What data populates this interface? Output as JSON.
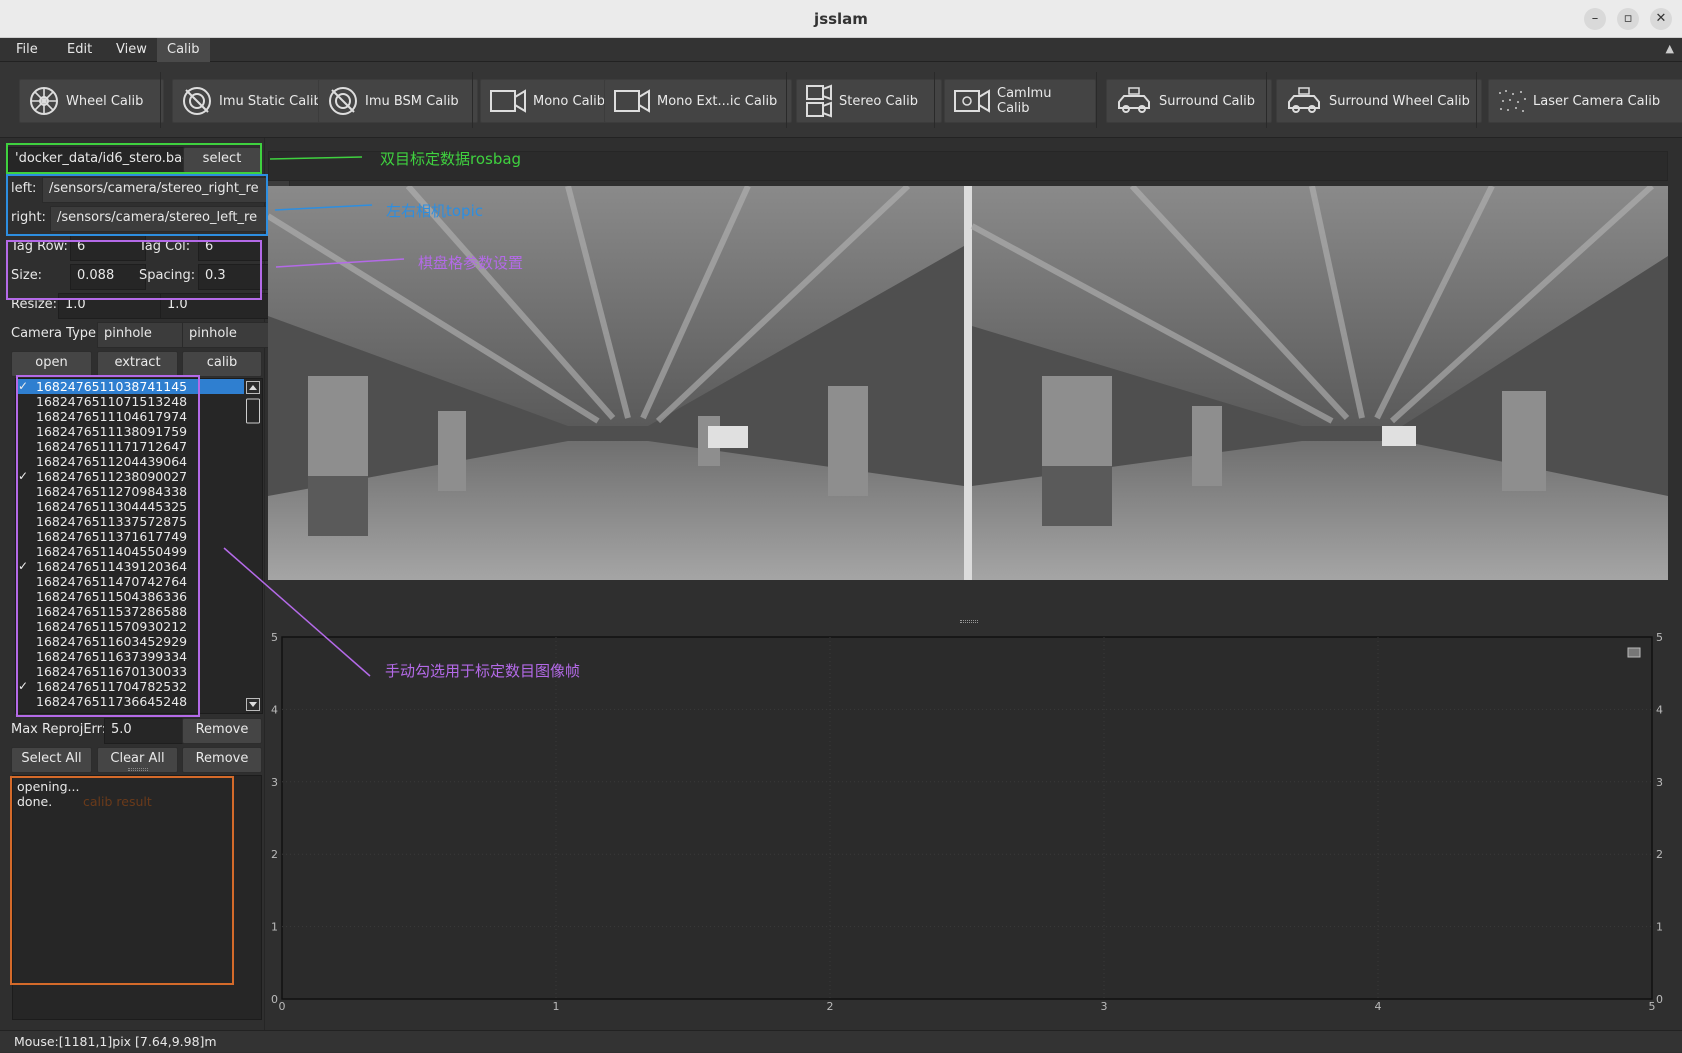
{
  "window": {
    "title": "jsslam"
  },
  "menubar": {
    "items": [
      "File",
      "Edit",
      "View",
      "Calib"
    ],
    "active": "Calib"
  },
  "toolbar": {
    "wheel_calib": "Wheel Calib",
    "imu_static_calib": "Imu Static Calib",
    "imu_bsm_calib": "Imu BSM Calib",
    "mono_calib": "Mono Calib",
    "mono_ext_calib": "Mono Ext...ic Calib",
    "stereo_calib": "Stereo Calib",
    "camimu_calib": "CamImu Calib",
    "surround_calib": "Surround Calib",
    "surround_wheel_calib": "Surround Wheel Calib",
    "laser_camera_calib": "Laser Camera Calib"
  },
  "bag": {
    "path": "'docker_data/id6_stero.bag",
    "select_label": "select"
  },
  "topics": {
    "left_label": "left:",
    "left_value": "/sensors/camera/stereo_right_re",
    "right_label": "right:",
    "right_value": "/sensors/camera/stereo_left_re"
  },
  "board": {
    "tag_row_label": "Tag Row:",
    "tag_row": "6",
    "tag_col_label": "Tag Col:",
    "tag_col": "6",
    "size_label": "Size:",
    "size": "0.088",
    "spacing_label": "Spacing:",
    "spacing": "0.3",
    "resize_label": "Resize:",
    "resize_1": "1.0",
    "resize_2": "1.0"
  },
  "camera": {
    "type_label": "Camera Type",
    "left_type": "pinhole",
    "right_type": "pinhole"
  },
  "actions": {
    "open": "open",
    "extract": "extract",
    "calib": "calib"
  },
  "frames": [
    {
      "id": "1682476511038741145",
      "checked": true,
      "selected": true
    },
    {
      "id": "1682476511071513248",
      "checked": false
    },
    {
      "id": "1682476511104617974",
      "checked": false
    },
    {
      "id": "1682476511138091759",
      "checked": false
    },
    {
      "id": "1682476511171712647",
      "checked": false
    },
    {
      "id": "1682476511204439064",
      "checked": false
    },
    {
      "id": "1682476511238090027",
      "checked": true
    },
    {
      "id": "1682476511270984338",
      "checked": false
    },
    {
      "id": "1682476511304445325",
      "checked": false
    },
    {
      "id": "1682476511337572875",
      "checked": false
    },
    {
      "id": "1682476511371617749",
      "checked": false
    },
    {
      "id": "1682476511404550499",
      "checked": false
    },
    {
      "id": "1682476511439120364",
      "checked": true
    },
    {
      "id": "1682476511470742764",
      "checked": false
    },
    {
      "id": "1682476511504386336",
      "checked": false
    },
    {
      "id": "1682476511537286588",
      "checked": false
    },
    {
      "id": "1682476511570930212",
      "checked": false
    },
    {
      "id": "1682476511603452929",
      "checked": false
    },
    {
      "id": "1682476511637399334",
      "checked": false
    },
    {
      "id": "1682476511670130033",
      "checked": false
    },
    {
      "id": "1682476511704782532",
      "checked": true
    },
    {
      "id": "1682476511736645248",
      "checked": false
    }
  ],
  "reproj": {
    "label": "Max ReprojErr:",
    "value": "5.0",
    "remove_label": "Remove"
  },
  "selection": {
    "select_all": "Select All",
    "clear_all": "Clear All",
    "remove": "Remove"
  },
  "log": {
    "lines": [
      "opening...",
      "done."
    ],
    "annotation": "calib result"
  },
  "annotations": {
    "bag": "双目标定数据rosbag",
    "topics": "左右相机topic",
    "board": "棋盘格参数设置",
    "frames": "手动勾选用于标定数目图像帧"
  },
  "colors": {
    "annot_green": "#3fd13f",
    "annot_blue": "#2d8ee0",
    "annot_violet": "#b46ae8",
    "annot_orange": "#d46a2a",
    "selection": "#2f7fd0"
  },
  "plot": {
    "x_ticks": [
      "0",
      "1",
      "2",
      "3",
      "4",
      "5"
    ],
    "y_ticks": [
      "0",
      "1",
      "2",
      "3",
      "4",
      "5"
    ]
  },
  "status": {
    "mouse": "Mouse:[1181,1]pix [7.64,9.98]m"
  }
}
